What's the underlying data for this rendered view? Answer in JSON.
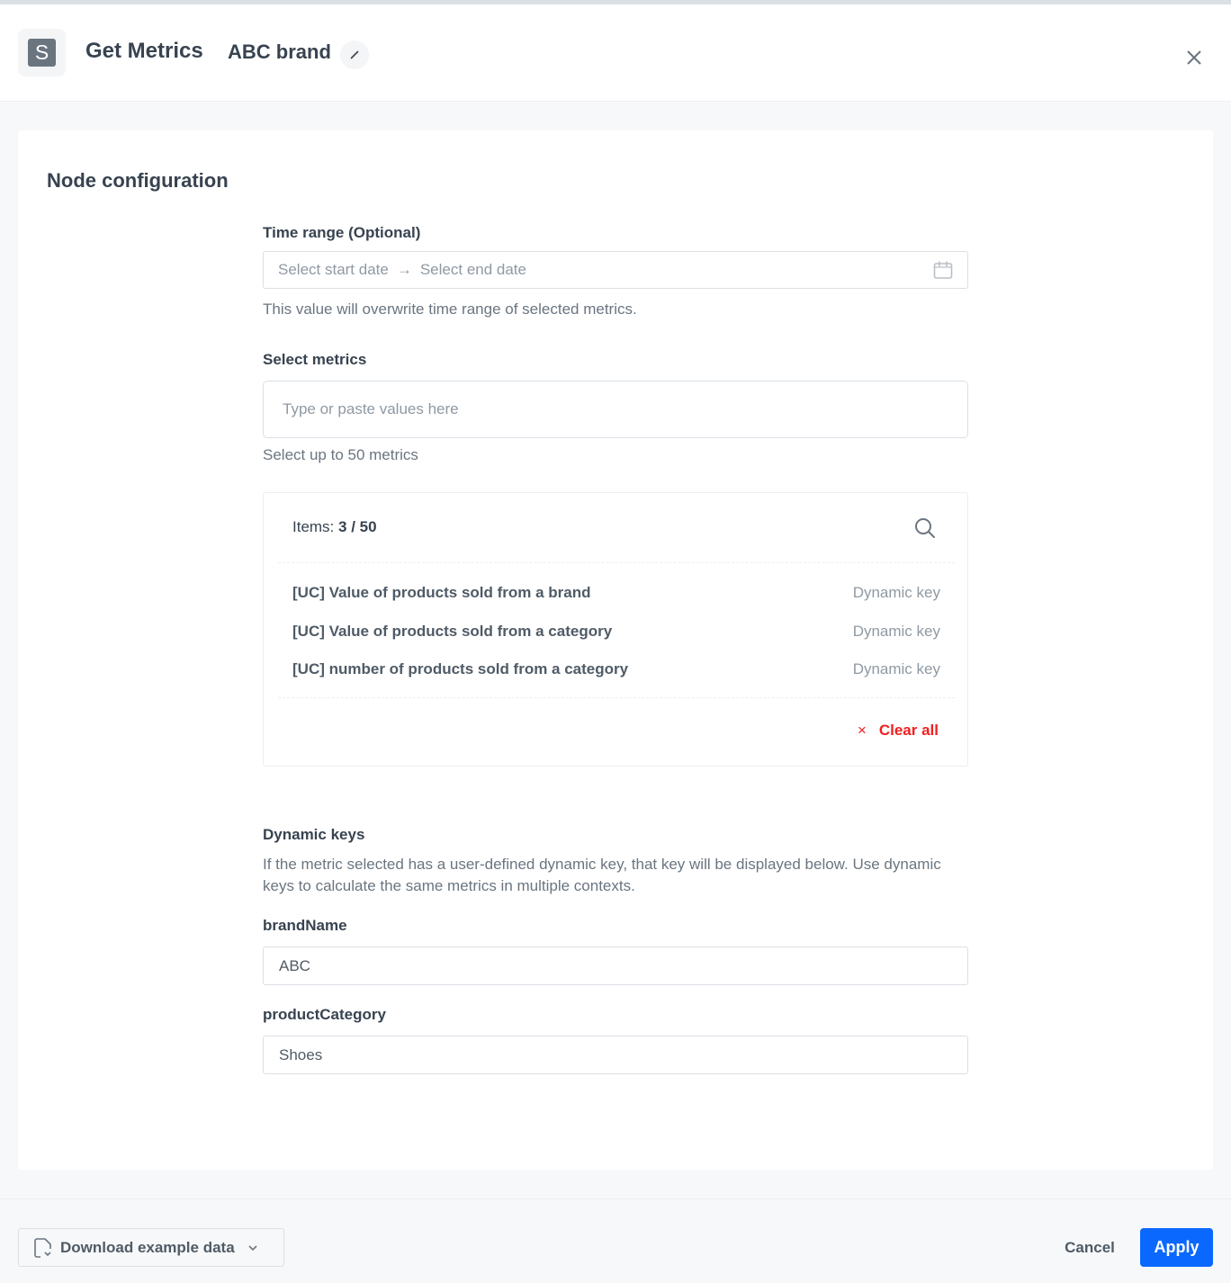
{
  "header": {
    "app_icon_letter": "S",
    "title": "Get Metrics",
    "node_name": "ABC brand"
  },
  "card": {
    "title": "Node configuration",
    "time_range": {
      "label": "Time range (Optional)",
      "start_placeholder": "Select start date",
      "arrow": "→",
      "end_placeholder": "Select end date",
      "helper": "This value will overwrite time range of selected metrics."
    },
    "metrics": {
      "label": "Select metrics",
      "placeholder": "Type or paste values here",
      "helper": "Select up to 50 metrics",
      "items_label": "Items:",
      "items_count": "3 / 50",
      "items": [
        {
          "name": "[UC] Value of products sold from a brand",
          "tag": "Dynamic key"
        },
        {
          "name": "[UC] Value of products sold from a category",
          "tag": "Dynamic key"
        },
        {
          "name": "[UC] number of products sold from a category",
          "tag": "Dynamic key"
        }
      ],
      "clear_all_icon": "×",
      "clear_all_label": "Clear all"
    },
    "dynamic_keys": {
      "label": "Dynamic keys",
      "description": "If the metric selected has a user-defined dynamic key, that key will be displayed below. Use dynamic keys to calculate the same metrics in multiple contexts.",
      "fields": [
        {
          "label": "brandName",
          "value": "ABC"
        },
        {
          "label": "productCategory",
          "value": "Shoes"
        }
      ]
    }
  },
  "footer": {
    "download_label": "Download example data",
    "cancel_label": "Cancel",
    "apply_label": "Apply"
  },
  "colors": {
    "accent": "#0b68ff",
    "danger": "#f21f1f",
    "text": "#384350",
    "muted": "#8f99a3"
  }
}
